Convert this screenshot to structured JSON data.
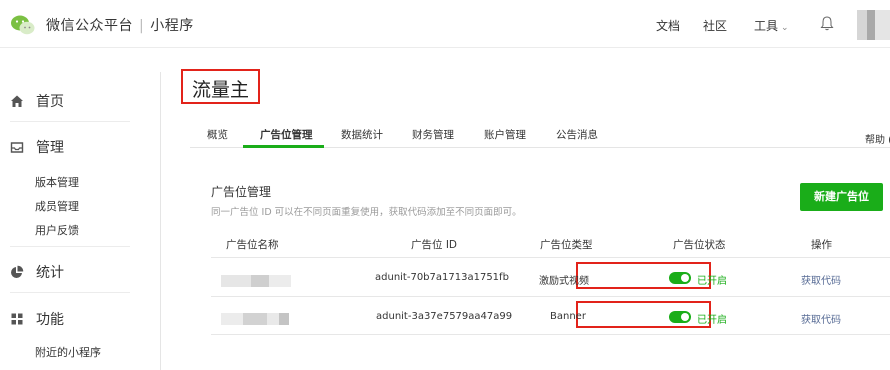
{
  "header": {
    "brand_title": "微信公众平台",
    "separator": "|",
    "brand_sub": "小程序",
    "nav": {
      "docs": "文档",
      "community": "社区",
      "tools": "工具",
      "tools_caret": "⌄"
    },
    "icons": [
      "wechat-logo-icon",
      "bell-icon",
      "chevron-down-icon"
    ]
  },
  "sidebar": {
    "home": "首页",
    "manage": "管理",
    "manage_items": [
      "版本管理",
      "成员管理",
      "用户反馈"
    ],
    "stats": "统计",
    "features": "功能",
    "feature_items": [
      "附近的小程序"
    ]
  },
  "main": {
    "title": "流量主",
    "tabs": [
      "概览",
      "广告位管理",
      "数据统计",
      "财务管理",
      "账户管理",
      "公告消息"
    ],
    "active_tab": "广告位管理",
    "help": "帮助 (",
    "section_title": "广告位管理",
    "section_desc": "同一广告位 ID 可以在不同页面重复使用，获取代码添加至不同页面即可。",
    "new_button": "新建广告位",
    "table": {
      "columns": [
        "广告位名称",
        "广告位 ID",
        "广告位类型",
        "广告位状态",
        "操作"
      ],
      "rows": [
        {
          "id": "adunit-70b7a1713a1751fb",
          "type": "激励式视频",
          "status": "已开启",
          "action": "获取代码"
        },
        {
          "id": "adunit-3a37e7579aa47a99",
          "type": "Banner",
          "status": "已开启",
          "action": "获取代码"
        }
      ]
    }
  },
  "colors": {
    "accent_green": "#1aad19",
    "highlight_red": "#e2231a",
    "link_blue": "#576b95"
  }
}
